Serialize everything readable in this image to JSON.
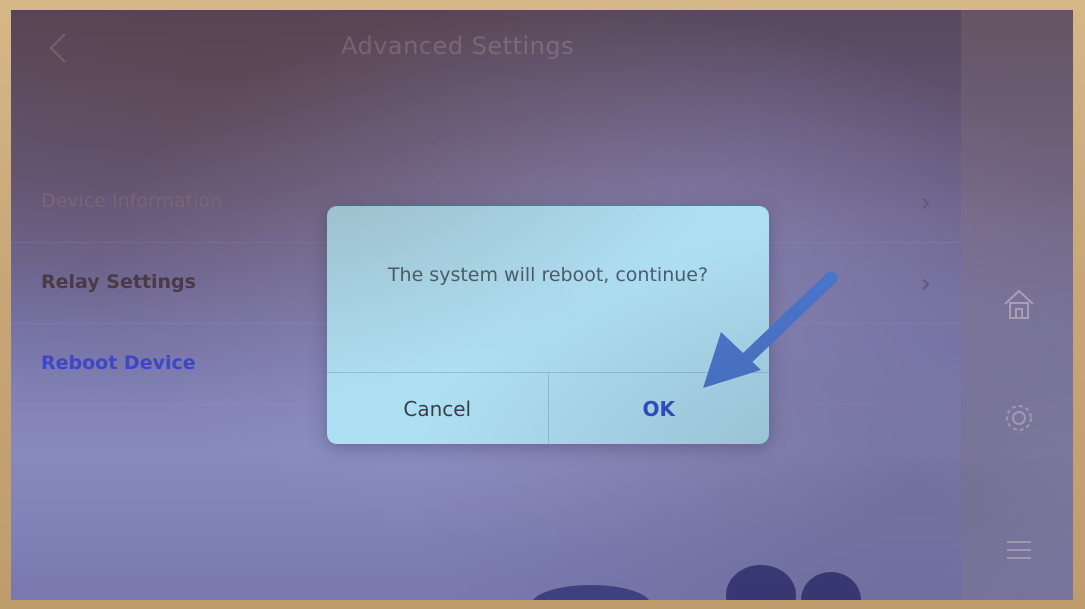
{
  "header": {
    "title": "Advanced Settings",
    "back_icon": "chevron-left-icon"
  },
  "menu": {
    "items": [
      {
        "label": "Device Information",
        "icon": "chevron-right-icon"
      },
      {
        "label": "Relay Settings",
        "icon": "chevron-right-icon"
      },
      {
        "label": "Reboot Device"
      }
    ]
  },
  "side_rail": {
    "icons": [
      "home-icon",
      "gear-icon",
      "menu-icon"
    ]
  },
  "dialog": {
    "message": "The system will reboot, continue?",
    "cancel_label": "Cancel",
    "ok_label": "OK"
  },
  "annotation": {
    "arrow_color": "#4a78d0"
  },
  "colors": {
    "dialog_bg": "#aee0f3",
    "ok_text": "#2e4ec8",
    "reboot_text": "#3c49d8",
    "bezel": "#c9a97a"
  }
}
